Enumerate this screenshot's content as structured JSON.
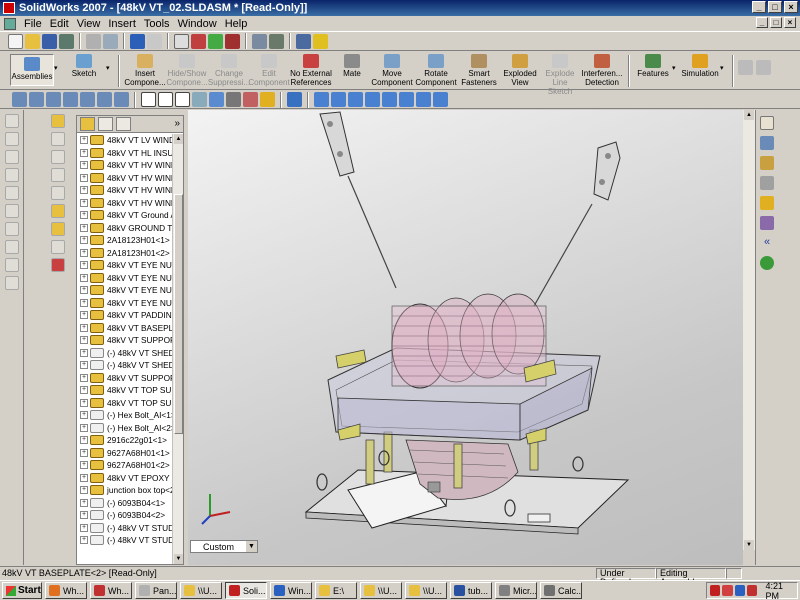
{
  "window": {
    "title": "SolidWorks 2007 - [48kV VT_02.SLDASM * [Read-Only]]",
    "controls": [
      "_",
      "□",
      "×"
    ]
  },
  "menubar": {
    "items": [
      "File",
      "Edit",
      "View",
      "Insert",
      "Tools",
      "Window",
      "Help"
    ],
    "doc_controls": [
      "_",
      "□",
      "×"
    ]
  },
  "command_manager": {
    "items": [
      {
        "label": "Assemblies",
        "icon": "assemblies-icon",
        "state": "selected"
      },
      {
        "label": "Sketch",
        "icon": "sketch-icon",
        "state": "enabled"
      },
      {
        "label": "Insert Compone...",
        "icon": "insert-components-icon",
        "state": "enabled"
      },
      {
        "label": "Hide/Show Compone...",
        "icon": "hide-show-icon",
        "state": "disabled"
      },
      {
        "label": "Change Suppressi...",
        "icon": "suppression-icon",
        "state": "disabled"
      },
      {
        "label": "Edit Component",
        "icon": "edit-component-icon",
        "state": "disabled"
      },
      {
        "label": "No External References",
        "icon": "no-external-ref-icon",
        "state": "enabled"
      },
      {
        "label": "Mate",
        "icon": "mate-icon",
        "state": "enabled"
      },
      {
        "label": "Move Component",
        "icon": "move-component-icon",
        "state": "enabled"
      },
      {
        "label": "Rotate Component",
        "icon": "rotate-component-icon",
        "state": "enabled"
      },
      {
        "label": "Smart Fasteners",
        "icon": "smart-fasteners-icon",
        "state": "enabled"
      },
      {
        "label": "Exploded View",
        "icon": "exploded-view-icon",
        "state": "enabled"
      },
      {
        "label": "Explode Line Sketch",
        "icon": "explode-line-icon",
        "state": "disabled"
      },
      {
        "label": "Interferen... Detection",
        "icon": "interference-icon",
        "state": "enabled"
      },
      {
        "label": "Features",
        "icon": "features-icon",
        "state": "enabled"
      },
      {
        "label": "Simulation",
        "icon": "simulation-icon",
        "state": "enabled"
      }
    ]
  },
  "feature_tree": {
    "more": "»",
    "rows": [
      {
        "label": "48kV VT LV WINDI",
        "kind": "assembly"
      },
      {
        "label": "48kV VT HL INSULA",
        "kind": "assembly"
      },
      {
        "label": "48kV VT HV WINDI",
        "kind": "assembly"
      },
      {
        "label": "48kV VT HV WINDI",
        "kind": "assembly"
      },
      {
        "label": "48kV VT HV WINDI",
        "kind": "assembly"
      },
      {
        "label": "48kV VT HV WINDI",
        "kind": "assembly"
      },
      {
        "label": "48kV VT Ground As",
        "kind": "assembly"
      },
      {
        "label": "48kV GROUND TER",
        "kind": "assembly"
      },
      {
        "label": "2A18123H01<1> (",
        "kind": "assembly"
      },
      {
        "label": "2A18123H01<2> (",
        "kind": "assembly"
      },
      {
        "label": "48kV VT EYE NUT<",
        "kind": "assembly"
      },
      {
        "label": "48kV VT EYE NUT<",
        "kind": "assembly"
      },
      {
        "label": "48kV VT EYE NUT<",
        "kind": "assembly"
      },
      {
        "label": "48kV VT EYE NUT<",
        "kind": "assembly"
      },
      {
        "label": "48kV VT PADDING<",
        "kind": "assembly"
      },
      {
        "label": "48kV VT BASEPLAT",
        "kind": "assembly"
      },
      {
        "label": "48kV VT SUPPORT",
        "kind": "assembly"
      },
      {
        "label": "(-) 48kV VT SHED L",
        "kind": "part"
      },
      {
        "label": "(-) 48kV VT SHED L",
        "kind": "part"
      },
      {
        "label": "48kV VT SUPPORT",
        "kind": "assembly"
      },
      {
        "label": "48kV VT TOP SUPP(",
        "kind": "assembly"
      },
      {
        "label": "48kV VT TOP SUPP(",
        "kind": "assembly"
      },
      {
        "label": "(-) Hex Bolt_AI<1>",
        "kind": "part"
      },
      {
        "label": "(-) Hex Bolt_AI<2>",
        "kind": "part"
      },
      {
        "label": "2916c22g01<1>",
        "kind": "assembly"
      },
      {
        "label": "9627A68H01<1>",
        "kind": "assembly"
      },
      {
        "label": "9627A68H01<2>",
        "kind": "assembly"
      },
      {
        "label": "48kV VT EPOXY CA",
        "kind": "assembly"
      },
      {
        "label": "junction box top<2",
        "kind": "assembly"
      },
      {
        "label": "(-) 6093B04<1>",
        "kind": "part"
      },
      {
        "label": "(-) 6093B04<2>",
        "kind": "part"
      },
      {
        "label": "(-) 48kV VT STUD T",
        "kind": "part"
      },
      {
        "label": "(-) 48kV VT STUD T",
        "kind": "part"
      }
    ]
  },
  "view": {
    "orientation_value": "Custom"
  },
  "statusbar": {
    "message": "48kV VT BASEPLATE<2> [Read-Only]",
    "definition": "Under Defined",
    "mode": "Editing Assembly"
  },
  "taskbar": {
    "start_label": "Start",
    "tasks": [
      {
        "label": "Wh...",
        "icon": "firefox-icon",
        "active": false
      },
      {
        "label": "Wh...",
        "icon": "document-icon",
        "active": false
      },
      {
        "label": "Pan...",
        "icon": "window-icon",
        "active": false
      },
      {
        "label": "\\\\U...",
        "icon": "folder-icon",
        "active": false
      },
      {
        "label": "Soli...",
        "icon": "solidworks-icon",
        "active": true
      },
      {
        "label": "Win...",
        "icon": "media-icon",
        "active": false
      },
      {
        "label": "E:\\",
        "icon": "folder-icon",
        "active": false
      },
      {
        "label": "\\\\U...",
        "icon": "folder-icon",
        "active": false
      },
      {
        "label": "\\\\U...",
        "icon": "folder-icon",
        "active": false
      },
      {
        "label": "tub...",
        "icon": "word-icon",
        "active": false
      },
      {
        "label": "Micr...",
        "icon": "app-icon",
        "active": false
      },
      {
        "label": "Calc...",
        "icon": "calculator-icon",
        "active": false
      }
    ],
    "clock": "4:21 PM"
  }
}
